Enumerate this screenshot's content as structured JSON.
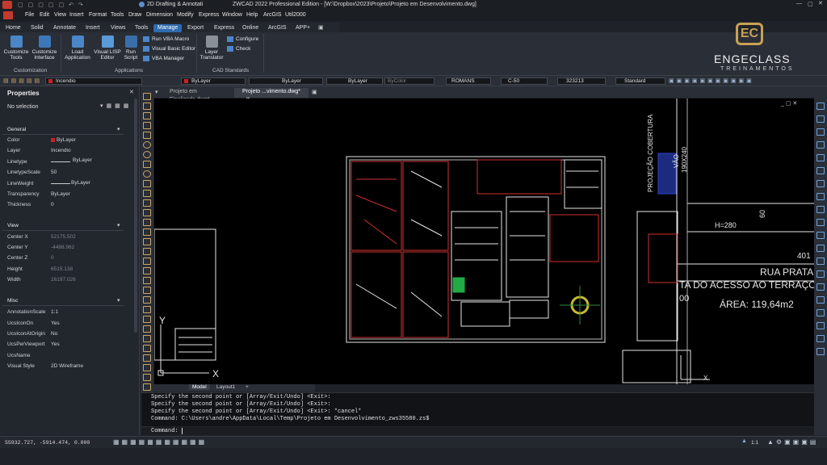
{
  "title": {
    "workspace": "2D Drafting & Annotati",
    "window": "ZWCAD 2022 Professional Edition - [W:\\Dropbox\\2023\\Projeto\\Projeto em Desenvolvimento.dwg]"
  },
  "menu": [
    "File",
    "Edit",
    "View",
    "Insert",
    "Format",
    "Tools",
    "Draw",
    "Dimension",
    "Modify",
    "Express",
    "Window",
    "Help",
    "ArcGIS",
    "Util2000"
  ],
  "ribbon_tabs": [
    "Home",
    "Solid",
    "Annotate",
    "Insert",
    "Views",
    "Tools",
    "Manage",
    "Export",
    "Express",
    "Online",
    "ArcGIS",
    "APP+"
  ],
  "active_tab": "Manage",
  "ribbon": {
    "customize_tools": "Customize Tools",
    "customize_interface": "Customize Interface",
    "load_application": "Load Application",
    "visual_lisp_editor": "Visual LISP Editor",
    "run_script": "Run Script",
    "run_vba_macro": "Run VBA Macro",
    "visual_basic_editor": "Visual Basic Editor",
    "vba_manager": "VBA Manager",
    "layer_translator": "Layer Translator",
    "configure": "Configure",
    "check": "Check",
    "group_customization": "Customization",
    "group_applications": "Applications",
    "group_cad_standards": "CAD Standards"
  },
  "logo": {
    "monogram": "EC",
    "name": "ENGECLASS",
    "tagline": "TREINAMENTOS"
  },
  "props_toolbar": {
    "layer": "Incendio",
    "color": "ByLayer",
    "linetype": "ByLayer",
    "lineweight": "ByLayer",
    "plotstyle": "ByColor",
    "textstyle": "ROMANS",
    "dimstyle": "C-50",
    "tablestyle": "323213",
    "mlstyle": "Standard"
  },
  "properties": {
    "title": "Properties",
    "selection": "No selection",
    "general_header": "General",
    "general": [
      {
        "k": "Color",
        "v": "ByLayer"
      },
      {
        "k": "Layer",
        "v": "Incendio"
      },
      {
        "k": "Linetype",
        "v": "ByLayer"
      },
      {
        "k": "LinetypeScale",
        "v": "50"
      },
      {
        "k": "LineWeight",
        "v": "ByLayer"
      },
      {
        "k": "Transparency",
        "v": "ByLayer"
      },
      {
        "k": "Thickness",
        "v": "0"
      }
    ],
    "view_header": "View",
    "view": [
      {
        "k": "Center X",
        "v": "52175.502"
      },
      {
        "k": "Center Y",
        "v": "-4488.962"
      },
      {
        "k": "Center Z",
        "v": "0"
      },
      {
        "k": "Height",
        "v": "6515.138"
      },
      {
        "k": "Width",
        "v": "16197.026"
      }
    ],
    "misc_header": "Misc",
    "misc": [
      {
        "k": "AnnotationScale",
        "v": "1:1"
      },
      {
        "k": "UcsIconOn",
        "v": "Yes"
      },
      {
        "k": "UcsIconAtOrigin",
        "v": "No"
      },
      {
        "k": "UcsPerViewport",
        "v": "Yes"
      },
      {
        "k": "UcsName",
        "v": ""
      },
      {
        "k": "Visual Style",
        "v": "2D Wireframe"
      }
    ]
  },
  "doc_tabs": [
    "Projeto em Finalizado.dwg*",
    "Projeto ...vimento.dwg*"
  ],
  "layout_tabs": [
    "Model",
    "Layout1",
    "+"
  ],
  "drawing_text": {
    "projecao": "PROJEÇÃO COBERTURA",
    "vao": "VÃO",
    "vao_dim": "190X240",
    "h280": "H=280",
    "dim60": "60",
    "dim401": "401",
    "rua": "RUA PRATA",
    "acesso": "TA DO ACESSO AO TERRAÇO",
    "area": "ÁREA: 119,64m2",
    "zero": "00",
    "axis_x": "X",
    "axis_y": "Y"
  },
  "command_history": [
    "Specify the second point or [Array/Exit/Undo] <Exit>:",
    "Specify the second point or [Array/Exit/Undo] <Exit>:",
    "Specify the second point or [Array/Exit/Undo] <Exit>: *cancel*",
    "Command: C:\\Users\\andre\\AppData\\Local\\Temp\\Projeto em Desenvolvimento_zws35580.zs$"
  ],
  "command_prompt": "Command:",
  "status": {
    "coords": "55932.727, -5914.474, 0.000",
    "scale": "1:1"
  }
}
